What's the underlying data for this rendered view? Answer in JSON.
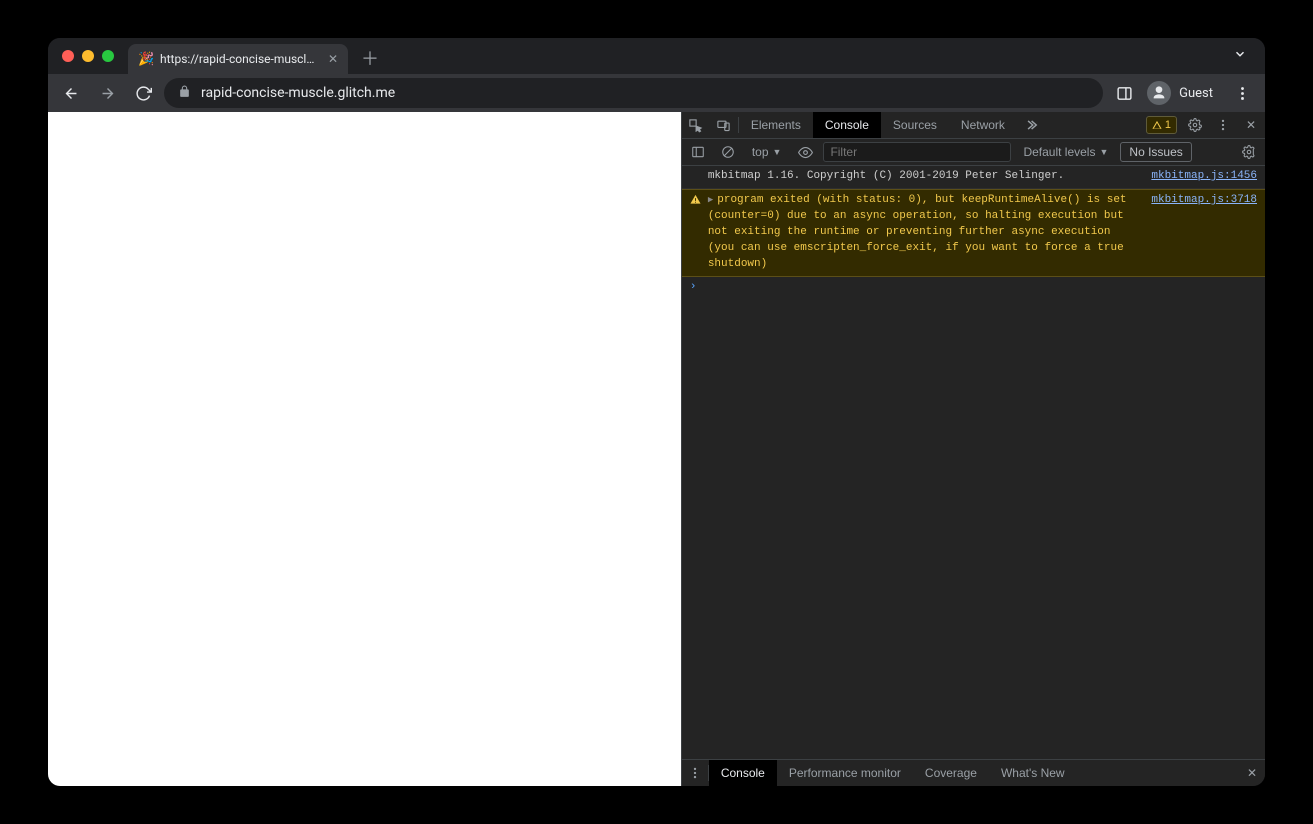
{
  "tab": {
    "title": "https://rapid-concise-muscle.g",
    "favicon": "party-popper"
  },
  "addressbar": {
    "url": "rapid-concise-muscle.glitch.me"
  },
  "profile": {
    "label": "Guest"
  },
  "devtools": {
    "tabs": {
      "elements": "Elements",
      "console": "Console",
      "sources": "Sources",
      "network": "Network"
    },
    "warning_count": "1",
    "console": {
      "context": "top",
      "filter_placeholder": "Filter",
      "levels_label": "Default levels",
      "issues_label": "No Issues"
    },
    "messages": [
      {
        "type": "log",
        "text": "mkbitmap 1.16. Copyright (C) 2001-2019 Peter Selinger.",
        "source": "mkbitmap.js:1456"
      },
      {
        "type": "warn",
        "text": "program exited (with status: 0), but keepRuntimeAlive() is set (counter=0) due to an async operation, so halting execution but not exiting the runtime or preventing further async execution (you can use emscripten_force_exit, if you want to force a true shutdown)",
        "source": "mkbitmap.js:3718"
      }
    ],
    "drawer": {
      "console": "Console",
      "perfmon": "Performance monitor",
      "coverage": "Coverage",
      "whatsnew": "What's New"
    }
  }
}
